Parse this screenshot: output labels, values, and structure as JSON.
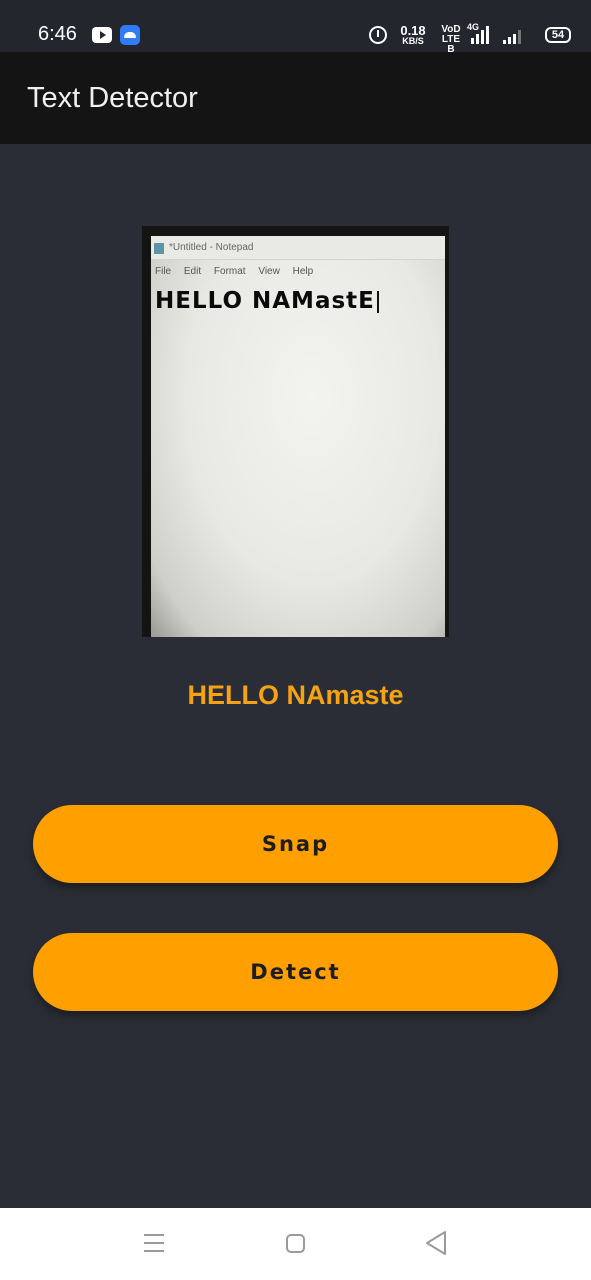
{
  "status_bar": {
    "time": "6:46",
    "net_speed_value": "0.18",
    "net_speed_unit": "KB/S",
    "volte_top": "VoD",
    "volte_bottom": "LTE B",
    "network_type": "4G",
    "battery": "54"
  },
  "app_bar": {
    "title": "Text Detector"
  },
  "captured_image": {
    "notepad_title": "*Untitled - Notepad",
    "notepad_menu": "File Edit Format View Help",
    "notepad_text": "HELLO NAMastE"
  },
  "result": {
    "detected_text": "HELLO NAmaste"
  },
  "buttons": {
    "snap": "Snap",
    "detect": "Detect"
  },
  "colors": {
    "background": "#2a2d35",
    "app_bar": "#141414",
    "accent": "#ffa000",
    "result_text": "#f5a312"
  },
  "icons": {
    "nav_menu": "recent-apps-icon",
    "nav_home": "home-icon",
    "nav_back": "back-icon"
  }
}
